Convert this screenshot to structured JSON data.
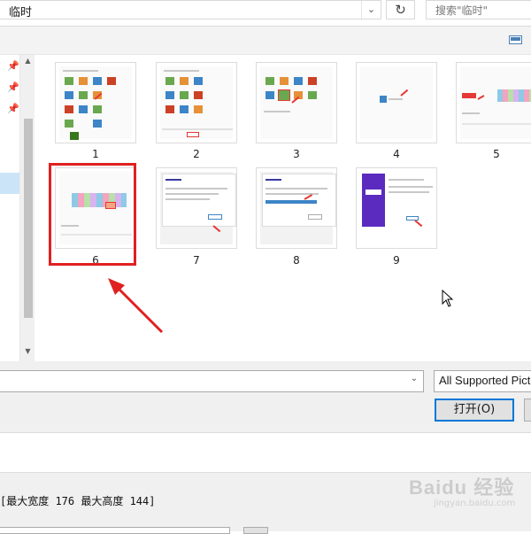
{
  "address_bar": {
    "path": "临时",
    "search_placeholder": "搜索\"临时\""
  },
  "thumbnails": [
    {
      "label": "1"
    },
    {
      "label": "2"
    },
    {
      "label": "3"
    },
    {
      "label": "4"
    },
    {
      "label": "5"
    },
    {
      "label": "6"
    },
    {
      "label": "7"
    },
    {
      "label": "8"
    },
    {
      "label": "9"
    }
  ],
  "file_type_filter": "All Supported Pict",
  "buttons": {
    "open": "打开(O)"
  },
  "size_hint": "[最大宽度 176 最大高度 144]",
  "watermark": {
    "brand": "Baidu 经验",
    "url": "jingyan.baidu.com"
  },
  "colors": {
    "annotation_red": "#e02020",
    "selection_blue": "#0078d7"
  }
}
